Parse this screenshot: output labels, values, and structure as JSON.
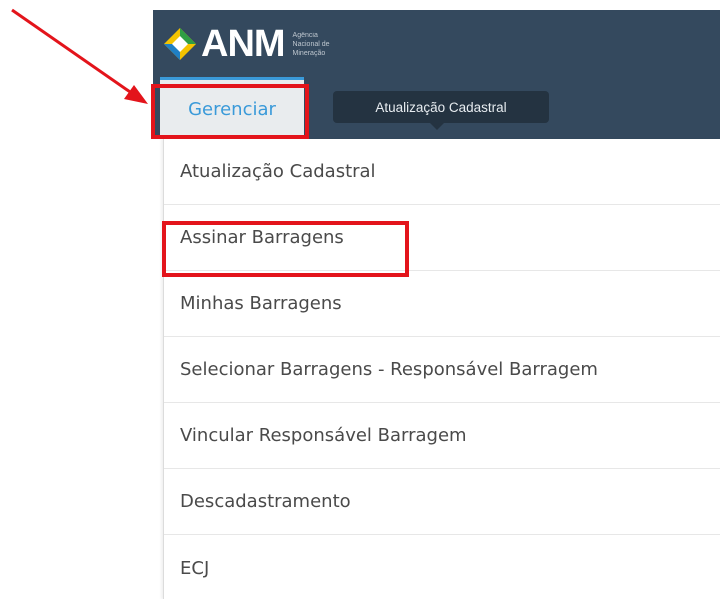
{
  "logo": {
    "text": "ANM",
    "subtitle_lines": [
      "Agência",
      "Nacional de",
      "Mineração"
    ]
  },
  "nav": {
    "active_tab_label": "Gerenciar",
    "tooltip": "Atualização Cadastral"
  },
  "menu": {
    "items": [
      {
        "label": "Atualização Cadastral"
      },
      {
        "label": "Assinar Barragens"
      },
      {
        "label": "Minhas Barragens"
      },
      {
        "label": "Selecionar Barragens - Responsável Barragem"
      },
      {
        "label": "Vincular Responsável Barragem"
      },
      {
        "label": "Descadastramento"
      },
      {
        "label": "ECJ"
      }
    ]
  },
  "colors": {
    "header_bg": "#34495e",
    "tab_accent": "#3a9ad9",
    "annotation_red": "#e3141b",
    "menu_text": "#4a4a4a"
  },
  "annotations": {
    "highlighted": [
      "Gerenciar",
      "Assinar Barragens"
    ]
  }
}
